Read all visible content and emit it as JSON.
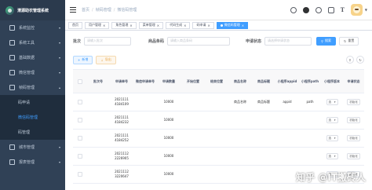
{
  "app": {
    "title": "渭源助农管理系统"
  },
  "sidebar": {
    "items": [
      {
        "label": "系统监控",
        "icon": "monitor-icon"
      },
      {
        "label": "系统工具",
        "icon": "tool-icon"
      },
      {
        "label": "基础数据",
        "icon": "data-icon"
      },
      {
        "label": "微信管理",
        "icon": "wechat-icon"
      },
      {
        "label": "帧码管理",
        "icon": "code-icon",
        "expanded": true
      },
      {
        "label": "城市管理",
        "icon": "city-icon"
      },
      {
        "label": "报表管理",
        "icon": "report-icon"
      }
    ],
    "subitems": [
      {
        "label": "码申请",
        "active": false
      },
      {
        "label": "微信码管理",
        "active": true
      },
      {
        "label": "码管理",
        "active": false
      }
    ]
  },
  "navbar": {
    "breadcrumb": [
      "首页",
      "帧码管理",
      "微信码管理"
    ],
    "font_label": "T",
    "icons": [
      "search-icon",
      "github-icon",
      "question-icon",
      "fullscreen-icon",
      "font-size-icon"
    ]
  },
  "tags": [
    {
      "label": "首页",
      "active": false
    },
    {
      "label": "用户管理",
      "active": false
    },
    {
      "label": "角色管理",
      "active": false
    },
    {
      "label": "菜单管理",
      "active": false
    },
    {
      "label": "代码生成",
      "active": false
    },
    {
      "label": "码申请",
      "active": false
    },
    {
      "label": "微信码管理",
      "active": true
    }
  ],
  "search": {
    "fields": [
      {
        "label": "批次",
        "placeholder": "请输入批次"
      },
      {
        "label": "商品条码",
        "placeholder": "请输入商品条码"
      },
      {
        "label": "申请状态",
        "placeholder": "请选择申请状态"
      }
    ],
    "search_btn": "搜索",
    "reset_btn": "重置"
  },
  "toolbar": {
    "add_btn": "新增",
    "export_btn": "导出",
    "right_icons": [
      "search-toggle-icon",
      "refresh-icon"
    ]
  },
  "table": {
    "columns": [
      "",
      "批次号",
      "申请单号",
      "微信申请单号",
      "申请数量",
      "开始位置",
      "结束位置",
      "商品名称",
      "商品标题",
      "小程序appid",
      "小程序path",
      "小程序版本",
      "申请状态"
    ],
    "rows": [
      {
        "batch": "",
        "apply_no": "2021111 4184109",
        "wx_no": "",
        "qty": "10000",
        "start": "",
        "end": "",
        "name": "商品名称",
        "title": "商品标题",
        "appid": "appid",
        "path": "path",
        "version": "选",
        "status": "初始化"
      },
      {
        "batch": "",
        "apply_no": "2021111 4184232",
        "wx_no": "",
        "qty": "10000",
        "start": "",
        "end": "",
        "name": "",
        "title": "",
        "appid": "",
        "path": "",
        "version": "选",
        "status": "初始化"
      },
      {
        "batch": "",
        "apply_no": "2021111 4184252",
        "wx_no": "",
        "qty": "10000",
        "start": "",
        "end": "",
        "name": "",
        "title": "",
        "appid": "",
        "path": "",
        "version": "选",
        "status": "初始化"
      },
      {
        "batch": "",
        "apply_no": "2021112 2226905",
        "wx_no": "",
        "qty": "10000",
        "start": "",
        "end": "",
        "name": "",
        "title": "",
        "appid": "",
        "path": "",
        "version": "选",
        "status": "初始化"
      },
      {
        "batch": "",
        "apply_no": "2021112 3220647",
        "wx_no": "",
        "qty": "10000",
        "start": "",
        "end": "",
        "name": "",
        "title": "",
        "appid": "",
        "path": "",
        "version": "选",
        "status": "初始化"
      }
    ]
  },
  "watermark": "知乎 @IT搬砖人",
  "colors": {
    "sidebar_bg": "#304156",
    "primary": "#409eff",
    "warning": "#e6a23c"
  }
}
